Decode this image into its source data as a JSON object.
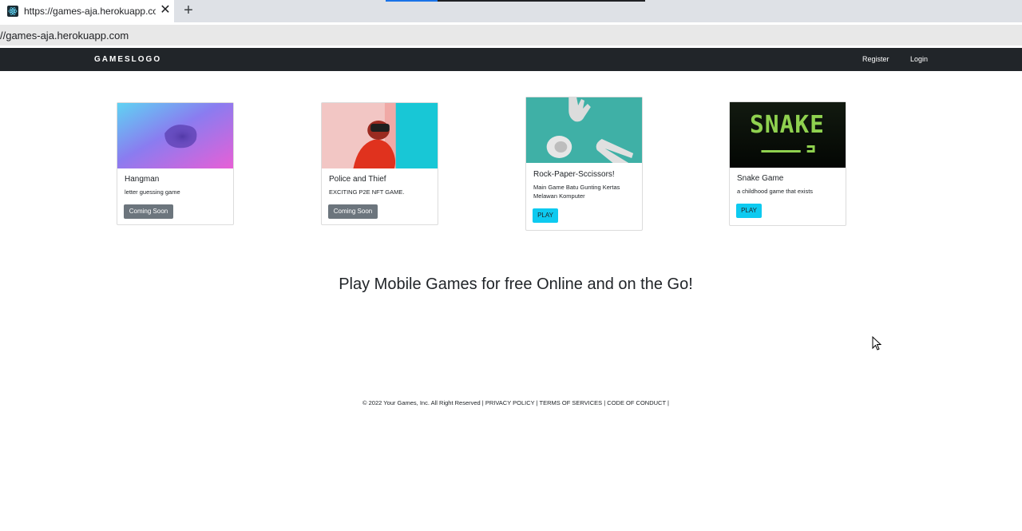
{
  "browser": {
    "tab_title": "https://games-aja.herokuapp.com",
    "tab_close": "✕",
    "new_tab": "+",
    "address": "//games-aja.herokuapp.com"
  },
  "navbar": {
    "brand": "GAMESLOGO",
    "register": "Register",
    "login": "Login"
  },
  "cards": [
    {
      "title": "Hangman",
      "text": "letter guessing game",
      "button": "Coming Soon"
    },
    {
      "title": "Police and Thief",
      "text": "EXCITING P2E NFT GAME.",
      "button": "Coming Soon"
    },
    {
      "title": "Rock-Paper-Sccissors!",
      "text": "Main Game Batu Gunting Kertas Melawan Komputer",
      "button": "PLAY"
    },
    {
      "title": "Snake Game",
      "text": "a childhood game that exists",
      "button": "PLAY",
      "image_text": "SNAKE"
    }
  ],
  "headline": "Play Mobile Games for free Online and on the Go!",
  "footer": {
    "copyright": "© 2022 Your Games, Inc. All Right Reserved | ",
    "privacy": "PRIVACY POLICY",
    "sep1": " | ",
    "terms": "TERMS OF SERVICES",
    "sep2": " | ",
    "conduct": "CODE OF CONDUCT",
    "sep3": " |"
  },
  "colors": {
    "navbar": "#212529",
    "btn_secondary": "#6c757d",
    "btn_info": "#0dcaf0",
    "snake_green": "#8fd14f"
  }
}
